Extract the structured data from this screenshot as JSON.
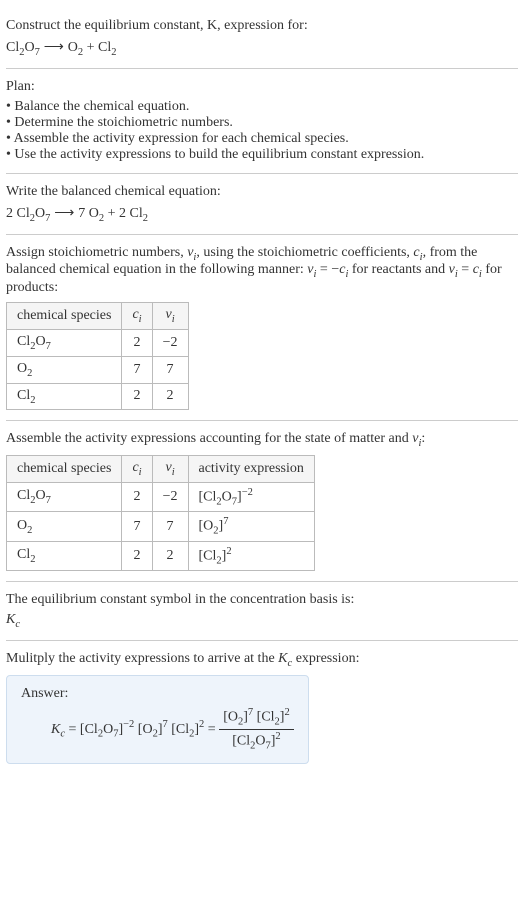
{
  "intro": {
    "line1": "Construct the equilibrium constant, K, expression for:",
    "reaction_lhs": "Cl",
    "reaction_lhs_sub1": "2",
    "reaction_lhs_mid": "O",
    "reaction_lhs_sub2": "7",
    "arrow": " ⟶ ",
    "reaction_rhs_a": "O",
    "reaction_rhs_a_sub": "2",
    "plus": " + ",
    "reaction_rhs_b": "Cl",
    "reaction_rhs_b_sub": "2"
  },
  "plan": {
    "heading": "Plan:",
    "b1": "• Balance the chemical equation.",
    "b2": "• Determine the stoichiometric numbers.",
    "b3": "• Assemble the activity expression for each chemical species.",
    "b4": "• Use the activity expressions to build the equilibrium constant expression."
  },
  "balanced": {
    "heading": "Write the balanced chemical equation:",
    "coef1": "2 ",
    "sp1a": "Cl",
    "sp1a_sub": "2",
    "sp1b": "O",
    "sp1b_sub": "7",
    "arrow": " ⟶ ",
    "coef2": "7 ",
    "sp2": "O",
    "sp2_sub": "2",
    "plus": " + ",
    "coef3": "2 ",
    "sp3": "Cl",
    "sp3_sub": "2"
  },
  "stoich": {
    "p1": "Assign stoichiometric numbers, ",
    "nu": "ν",
    "sub_i": "i",
    "p2": ", using the stoichiometric coefficients, ",
    "c": "c",
    "p3": ", from the balanced chemical equation in the following manner: ",
    "eq1a": "ν",
    "eq1b": " = −",
    "eq1c": "c",
    "p4": " for reactants and ",
    "eq2a": "ν",
    "eq2b": " = ",
    "eq2c": "c",
    "p5": " for products:",
    "th1": "chemical species",
    "th2": "c",
    "th3": "ν",
    "r1": {
      "sp_a": "Cl",
      "sp_a_sub": "2",
      "sp_b": "O",
      "sp_b_sub": "7",
      "c": "2",
      "nu": "−2"
    },
    "r2": {
      "sp": "O",
      "sp_sub": "2",
      "c": "7",
      "nu": "7"
    },
    "r3": {
      "sp": "Cl",
      "sp_sub": "2",
      "c": "2",
      "nu": "2"
    }
  },
  "activity": {
    "heading": "Assemble the activity expressions accounting for the state of matter and ",
    "nu": "ν",
    "sub_i": "i",
    "colon": ":",
    "th1": "chemical species",
    "th2": "c",
    "th3": "ν",
    "th4": "activity expression",
    "r1": {
      "sp_a": "Cl",
      "sp_a_sub": "2",
      "sp_b": "O",
      "sp_b_sub": "7",
      "c": "2",
      "nu": "−2",
      "act_l": "[Cl",
      "act_sub1": "2",
      "act_m": "O",
      "act_sub2": "7",
      "act_r": "]",
      "act_exp": "−2"
    },
    "r2": {
      "sp": "O",
      "sp_sub": "2",
      "c": "7",
      "nu": "7",
      "act_l": "[O",
      "act_sub": "2",
      "act_r": "]",
      "act_exp": "7"
    },
    "r3": {
      "sp": "Cl",
      "sp_sub": "2",
      "c": "2",
      "nu": "2",
      "act_l": "[Cl",
      "act_sub": "2",
      "act_r": "]",
      "act_exp": "2"
    }
  },
  "symbol": {
    "line": "The equilibrium constant symbol in the concentration basis is:",
    "K": "K",
    "sub": "c"
  },
  "result": {
    "heading": "Mulitply the activity expressions to arrive at the ",
    "K": "K",
    "sub": "c",
    "heading2": " expression:",
    "answer_label": "Answer:",
    "lhs_K": "K",
    "lhs_sub": "c",
    "eq": " = ",
    "t1_l": "[Cl",
    "t1_s1": "2",
    "t1_m": "O",
    "t1_s2": "7",
    "t1_r": "]",
    "t1_e": "−2",
    "sp": " ",
    "t2_l": "[O",
    "t2_s": "2",
    "t2_r": "]",
    "t2_e": "7",
    "t3_l": "[Cl",
    "t3_s": "2",
    "t3_r": "]",
    "t3_e": "2",
    "eq2": " = ",
    "num_a_l": "[O",
    "num_a_s": "2",
    "num_a_r": "]",
    "num_a_e": "7",
    "num_b_l": "[Cl",
    "num_b_s": "2",
    "num_b_r": "]",
    "num_b_e": "2",
    "den_l": "[Cl",
    "den_s1": "2",
    "den_m": "O",
    "den_s2": "7",
    "den_r": "]",
    "den_e": "2"
  }
}
